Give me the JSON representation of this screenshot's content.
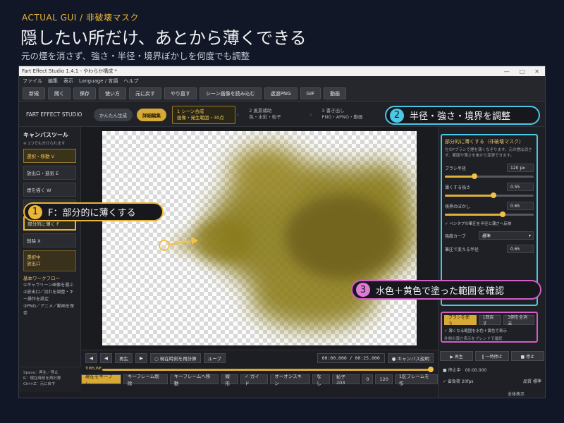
{
  "hero": {
    "kicker": "ACTUAL GUI / 非破壊マスク",
    "title": "隠したい所だけ、あとから薄くできる",
    "subtitle": "元の煙を消さず、強さ・半径・境界ぼかしを何度でも調整"
  },
  "window": {
    "title": "Fart Effect Studio 1.4.1 - やわらか構成 *",
    "controls": [
      "—",
      "□",
      "✕"
    ],
    "menu": [
      "ファイル",
      "編集",
      "表示",
      "Language / 言語",
      "ヘルプ"
    ],
    "toolbar": [
      "新規",
      "開く",
      "保存",
      "使い方",
      "元に戻す",
      "やり直す",
      "シーン画像を読み込む",
      "透過PNG",
      "GIF",
      "動画"
    ]
  },
  "studio": {
    "name": "FART EFFECT STUDIO",
    "mode_simple": "かんたん生成",
    "mode_detail": "詳細編集",
    "steps": [
      {
        "title": "1 シーン合成",
        "sub": "画像・発生範囲・30点"
      },
      {
        "title": "2 風景補助",
        "sub": "色・水彩・粒子"
      },
      {
        "title": "3 書き出し",
        "sub": "PNG・APNG・動画"
      }
    ]
  },
  "left_panel": {
    "title": "キャンバスツール",
    "hint": "※ 1つでも分けられます",
    "tools": [
      "選択・移動 V",
      "放出口・進気 E",
      "煙を描く W",
      "",
      "部分的に薄く F",
      "削除 X"
    ],
    "emitter_label": "選択中",
    "emitter_value": "放出口",
    "guide_title": "基本ワークフロー",
    "guide_items": [
      "①ギャラリーン画像を選ぶ",
      "②放出口／流れを調整・キー操作を設定",
      "③PNG／アニメ／動画を保存"
    ],
    "shortcuts": [
      "Space：再生／停止",
      "R：現在時刻を再計算",
      "Ctrl+Z：元に戻す"
    ]
  },
  "right_panel": {
    "heading": "部分的に薄くする（非破壊マスク）",
    "description": "左のFブラシで煙を薄くなぞります。元の煙は消さず、範囲や薄さを後から変更できます。",
    "brush_radius_label": "ブラシ半径",
    "brush_radius_value": "120 px",
    "brush_radius_level": 0.33,
    "strength_label": "薄くする強さ",
    "strength_value": "0.55",
    "strength_level": 0.55,
    "feather_label": "境界のぼかし",
    "feather_value": "0.65",
    "feather_level": 0.65,
    "pen_check": "✓ ペンタブの筆圧を半径と薄さへ反映",
    "curve_label": "強度カーブ",
    "curve_value": "標準",
    "scale_label": "筆圧で変える半径",
    "scale_value": "0.65",
    "brush_buttons": [
      "ブラシを使う",
      "1回戻す",
      "3倒を全消去"
    ],
    "show_check": "✓ 薄くなる範囲を水色＋黄色で表示",
    "show_note": "外側の薄さ表示をブレンドで確認",
    "play_buttons": [
      "▶ 再生",
      "‖ 一時停止",
      "■ 停止"
    ],
    "status_line": "■ 停止中　00:00.000",
    "fps_check": "✓ 省負荷 20fps",
    "quality_label": "品質",
    "quality_value": "標準",
    "view_all": "全体表示"
  },
  "timeline": {
    "buttons": [
      "◀",
      "◀",
      "再生",
      "▶",
      "○ 現在時刻を再計算",
      "ループ"
    ],
    "time": "00:00.000 / 00:25.000",
    "canvas_btn": "● キャンバス説明",
    "track_label": "TIMELINE",
    "position": 1.0,
    "row2": [
      "現在をキーフレ",
      "キーフレーム削除",
      "キーフレームへ移動",
      "線形",
      "✓ ガイド",
      "オーオンスキン",
      "なし",
      "粒子 203",
      "0",
      "120",
      "1区フレームを作"
    ]
  },
  "annotations": [
    {
      "num": "1",
      "text": "F：部分的に薄くする"
    },
    {
      "num": "2",
      "text": "半径・強さ・境界を調整"
    },
    {
      "num": "3",
      "text": "水色＋黄色で塗った範囲を確認"
    }
  ]
}
